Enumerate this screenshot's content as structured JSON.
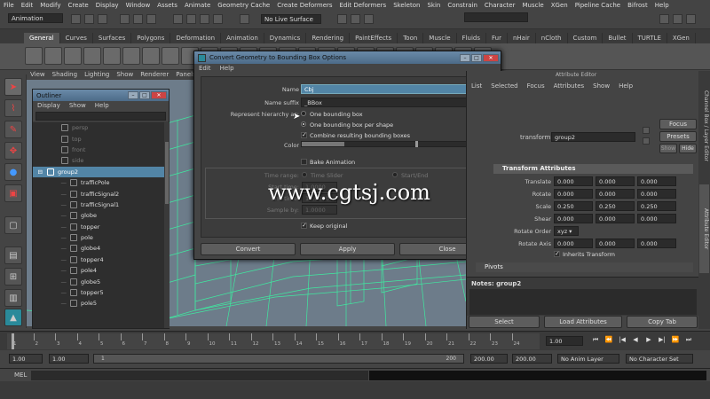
{
  "app": {
    "menu": [
      "File",
      "Edit",
      "Modify",
      "Create",
      "Display",
      "Window",
      "Assets",
      "Animate",
      "Geometry Cache",
      "Create Deformers",
      "Edit Deformers",
      "Skeleton",
      "Skin",
      "Constrain",
      "Character",
      "Muscle",
      "XGen",
      "Pipeline Cache",
      "Bifrost",
      "Help"
    ],
    "mode_dropdown": "Animation",
    "live_surface": "No Live Surface"
  },
  "shelf_tabs": [
    "General",
    "Curves",
    "Surfaces",
    "Polygons",
    "Deformation",
    "Animation",
    "Dynamics",
    "Rendering",
    "PaintEffects",
    "Toon",
    "Muscle",
    "Fluids",
    "Fur",
    "nHair",
    "nCloth",
    "Custom",
    "Bullet",
    "TURTLE",
    "XGen"
  ],
  "shelf_active": "General",
  "viewport_menu": [
    "View",
    "Shading",
    "Lighting",
    "Show",
    "Renderer",
    "Panels"
  ],
  "outliner": {
    "title": "Outliner",
    "menu": [
      "Display",
      "Show",
      "Help"
    ],
    "items": [
      {
        "label": "persp",
        "dim": true,
        "depth": 1
      },
      {
        "label": "top",
        "dim": true,
        "depth": 1
      },
      {
        "label": "front",
        "dim": true,
        "depth": 1
      },
      {
        "label": "side",
        "dim": true,
        "depth": 1
      },
      {
        "label": "group2",
        "selected": true,
        "depth": 0
      },
      {
        "label": "trafficPole",
        "depth": 2
      },
      {
        "label": "trafficSignal2",
        "depth": 2
      },
      {
        "label": "trafficSignal1",
        "depth": 2
      },
      {
        "label": "globe",
        "depth": 2
      },
      {
        "label": "topper",
        "depth": 2
      },
      {
        "label": "pole",
        "depth": 2
      },
      {
        "label": "globe4",
        "depth": 2
      },
      {
        "label": "topper4",
        "depth": 2
      },
      {
        "label": "pole4",
        "depth": 2
      },
      {
        "label": "globe5",
        "depth": 2
      },
      {
        "label": "topper5",
        "depth": 2
      },
      {
        "label": "pole5",
        "depth": 2
      }
    ]
  },
  "dialog": {
    "title": "Convert Geometry to Bounding Box Options",
    "menu": [
      "Edit",
      "Help"
    ],
    "name_label": "Name",
    "name_value": "Cbj",
    "suffix_label": "Name suffix",
    "suffix_value": "_BBox",
    "hierarchy_label": "Represent hierarchy as:",
    "opt_one_bbox": "One bounding box",
    "opt_per_shape": "One bounding box per shape",
    "combine_label": "Combine resulting bounding boxes",
    "color_label": "Color",
    "bake_label": "Bake Animation",
    "time_range_label": "Time range:",
    "time_slider_opt": "Time Slider",
    "start_end_opt": "Start/End",
    "start_time_label": "Start time:",
    "start_time_value": "1.0000",
    "end_time_label": "End time:",
    "end_time_value": "10.0000",
    "sample_by_label": "Sample by:",
    "sample_by_value": "1.0000",
    "keep_label": "Keep original",
    "buttons": {
      "convert": "Convert",
      "apply": "Apply",
      "close": "Close"
    }
  },
  "attr_editor": {
    "title": "Attribute Editor",
    "menu": [
      "List",
      "Selected",
      "Focus",
      "Attributes",
      "Show",
      "Help"
    ],
    "transform_label": "transform:",
    "transform_value": "group2",
    "focus_btn": "Focus",
    "presets_btn": "Presets",
    "show_btn": "Show",
    "hide_btn": "Hide",
    "section_transform": "Transform Attributes",
    "translate_label": "Translate",
    "translate": [
      "0.000",
      "0.000",
      "0.000"
    ],
    "rotate_label": "Rotate",
    "rotate": [
      "0.000",
      "0.000",
      "0.000"
    ],
    "scale_label": "Scale",
    "scale": [
      "0.250",
      "0.250",
      "0.250"
    ],
    "shear_label": "Shear",
    "shear": [
      "0.000",
      "0.000",
      "0.000"
    ],
    "rotate_order_label": "Rotate Order",
    "rotate_order": "xyz",
    "rotate_axis_label": "Rotate Axis",
    "rotate_axis": [
      "0.000",
      "0.000",
      "0.000"
    ],
    "inherits_label": "Inherits Transform",
    "section_pivots": "Pivots",
    "notes_label": "Notes:  group2",
    "select_btn": "Select",
    "load_btn": "Load Attributes",
    "copy_btn": "Copy Tab"
  },
  "side_tabs": [
    "Channel Box / Layer Editor",
    "Attribute Editor"
  ],
  "timeline": {
    "ticks": [
      "1",
      "2",
      "3",
      "4",
      "5",
      "6",
      "7",
      "8",
      "9",
      "10",
      "11",
      "12",
      "13",
      "14",
      "15",
      "16",
      "17",
      "18",
      "19",
      "20",
      "21",
      "22",
      "23",
      "24"
    ],
    "current": "1.00"
  },
  "range": {
    "start": "1.00",
    "start2": "1.00",
    "frame": "1",
    "end_inner": "200",
    "end": "200.00",
    "end2": "200.00",
    "anim_layer": "No Anim Layer",
    "char_set": "No Character Set"
  },
  "cmd": {
    "label": "MEL"
  },
  "watermark": "www.cgtsj.com"
}
